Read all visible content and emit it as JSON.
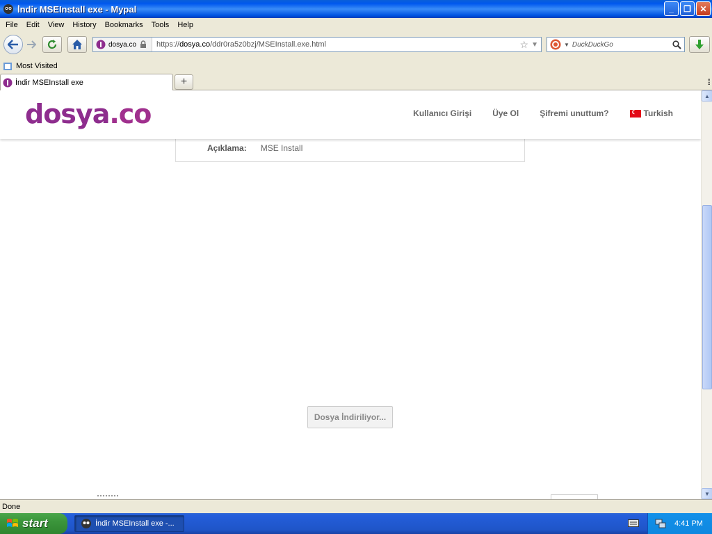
{
  "window": {
    "title": "İndir MSEInstall exe - Mypal"
  },
  "menu": [
    "File",
    "Edit",
    "View",
    "History",
    "Bookmarks",
    "Tools",
    "Help"
  ],
  "navbar": {
    "site_identity": "dosya.co",
    "url_prefix": "https://",
    "url_domain": "dosya.co",
    "url_path": "/ddr0ra5z0bzj/MSEInstall.exe.html",
    "search_placeholder": "DuckDuckGo"
  },
  "bookmarks": {
    "most_visited": "Most Visited"
  },
  "tabs": [
    {
      "label": "İndir MSEInstall exe"
    }
  ],
  "page": {
    "logo_main": "dosya",
    "logo_dot": ".co",
    "nav": {
      "login": "Kullanıcı Girişi",
      "signup": "Üye Ol",
      "forgot": "Şifremi unuttum?",
      "language": "Turkish"
    },
    "info": {
      "label": "Açıklama:",
      "value": "MSE Install"
    },
    "download_status": "Dosya İndiriliyor..."
  },
  "status": "Done",
  "taskbar": {
    "start": "start",
    "task_label": "İndir MSEInstall exe -...",
    "clock": "4:41 PM"
  },
  "colors": {
    "brand": "#8e2d8e",
    "xp_blue": "#0054e3",
    "start_green": "#3b953b"
  }
}
